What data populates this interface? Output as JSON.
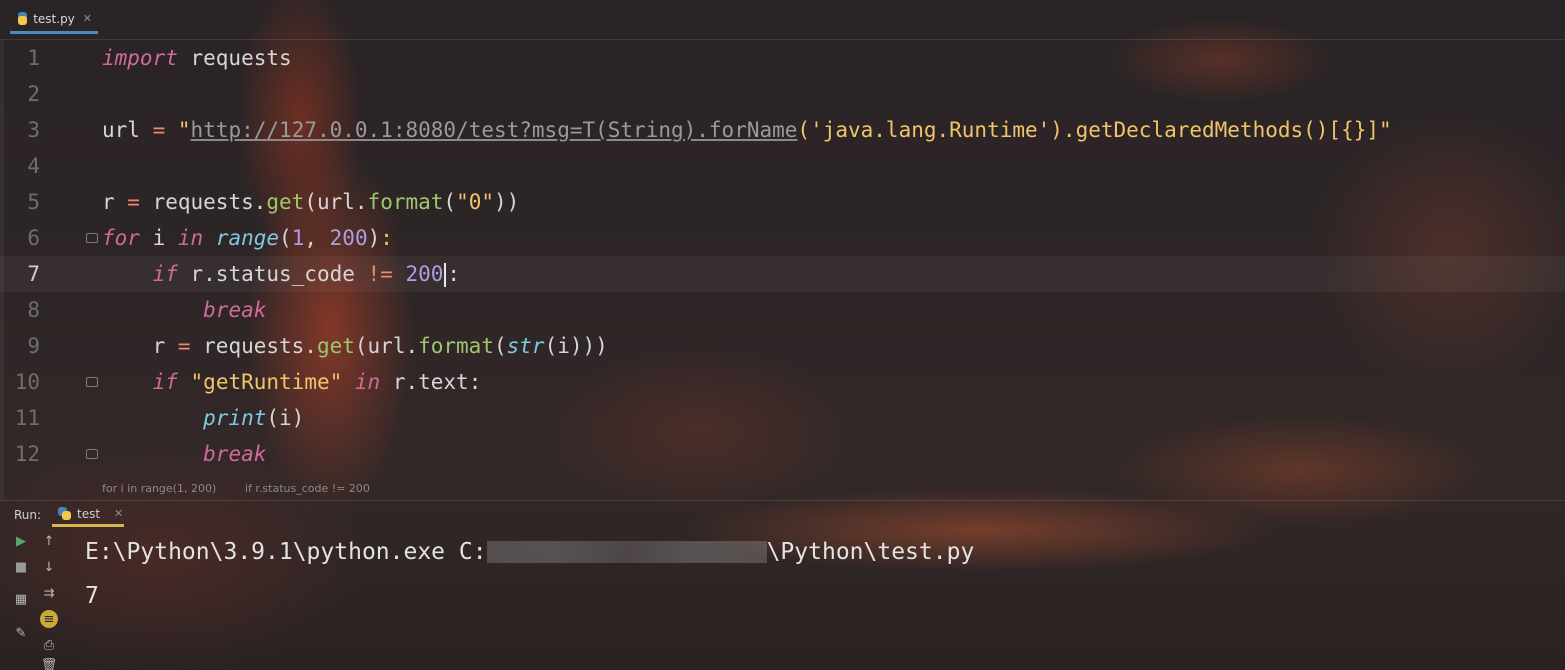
{
  "tab": {
    "filename": "test.py",
    "icon": "python-file-icon"
  },
  "editor": {
    "line_numbers": [
      "1",
      "2",
      "3",
      "4",
      "5",
      "6",
      "7",
      "8",
      "9",
      "10",
      "11",
      "12"
    ],
    "current_line": "7"
  },
  "breadcrumb": [
    "for i in range(1, 200)",
    "if r.status_code != 200"
  ],
  "run": {
    "label": "Run:",
    "tab_name": "test",
    "console": {
      "cmd_prefix": "E:\\Python\\3.9.1\\python.exe C:",
      "cmd_suffix": "\\Python\\test.py",
      "output": "7"
    }
  },
  "colors": {
    "keyword": "#cf6a9b",
    "string": "#f0c46a",
    "number": "#b09ce3",
    "function": "#9ec66d",
    "builtin": "#7ec9e0",
    "tab_underline": "#4a88c7",
    "run_tab_underline": "#d6b84a"
  }
}
